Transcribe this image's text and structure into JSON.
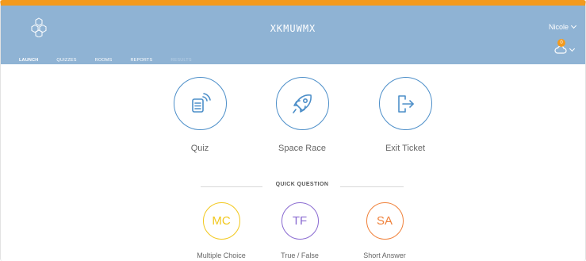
{
  "header": {
    "room_name": "XKMUWMX",
    "user_name": "Nicole",
    "notification_count": "0",
    "colors": {
      "header_bg": "#8fb3d4",
      "accent": "#f39a1e"
    }
  },
  "tabs": [
    {
      "label": "LAUNCH",
      "state": "active"
    },
    {
      "label": "QUIZZES",
      "state": "normal"
    },
    {
      "label": "ROOMS",
      "state": "normal"
    },
    {
      "label": "REPORTS",
      "state": "normal"
    },
    {
      "label": "RESULTS",
      "state": "disabled"
    }
  ],
  "launch": {
    "items": [
      {
        "label": "Quiz",
        "icon": "quiz-document-icon"
      },
      {
        "label": "Space Race",
        "icon": "rocket-icon"
      },
      {
        "label": "Exit Ticket",
        "icon": "exit-door-icon"
      }
    ]
  },
  "quick_question": {
    "title": "QUICK QUESTION",
    "items": [
      {
        "abbr": "MC",
        "label": "Multiple Choice",
        "color": "#f2c81d"
      },
      {
        "abbr": "TF",
        "label": "True / False",
        "color": "#8a6bd1"
      },
      {
        "abbr": "SA",
        "label": "Short Answer",
        "color": "#f0813a"
      }
    ]
  }
}
